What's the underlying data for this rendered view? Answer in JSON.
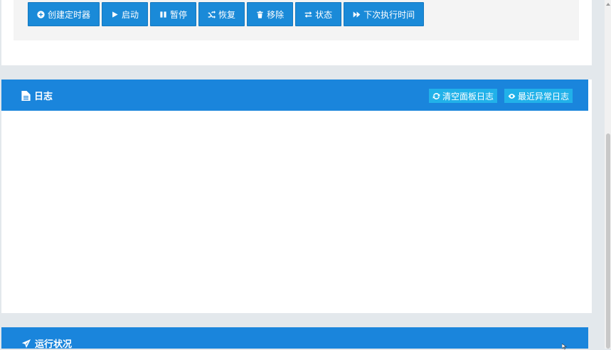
{
  "toolbar": {
    "buttons": [
      {
        "label": "创建定时器",
        "icon": "plus-circle-icon"
      },
      {
        "label": "启动",
        "icon": "play-icon"
      },
      {
        "label": "暂停",
        "icon": "pause-icon"
      },
      {
        "label": "恢复",
        "icon": "random-icon"
      },
      {
        "label": "移除",
        "icon": "trash-icon"
      },
      {
        "label": "状态",
        "icon": "exchange-icon"
      },
      {
        "label": "下次执行时间",
        "icon": "fast-forward-icon"
      }
    ]
  },
  "log_panel": {
    "title": "日志",
    "title_icon": "file-icon",
    "actions": [
      {
        "label": "清空面板日志",
        "icon": "refresh-icon"
      },
      {
        "label": "最近异常日志",
        "icon": "eye-icon"
      }
    ]
  },
  "status_panel": {
    "title": "运行状况",
    "title_icon": "paper-plane-icon"
  },
  "colors": {
    "primary": "#1a8ad8",
    "panel_header": "#1a85dc",
    "info": "#21b1e9",
    "background": "#e3e8ec"
  }
}
